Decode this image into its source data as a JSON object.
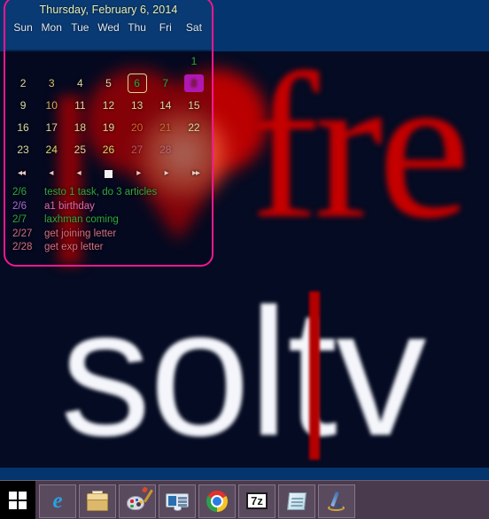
{
  "desktop": {
    "wallpaper": {
      "word_free": "fre",
      "word_soft": "soltv",
      "background_color": "#050b22",
      "band_color": "#05356e",
      "accent_red": "#c40000"
    }
  },
  "calendar_widget": {
    "title": "Thursday, February 6, 2014",
    "border_color": "#f2178f",
    "header_color": "#0a3a73",
    "day_headers": [
      "Sun",
      "Mon",
      "Tue",
      "Wed",
      "Thu",
      "Fri",
      "Sat"
    ],
    "weeks": [
      [
        {
          "label": "",
          "state": "empty",
          "color": ""
        },
        {
          "label": "",
          "state": "empty",
          "color": ""
        },
        {
          "label": "",
          "state": "empty",
          "color": ""
        },
        {
          "label": "",
          "state": "empty",
          "color": ""
        },
        {
          "label": "",
          "state": "empty",
          "color": ""
        },
        {
          "label": "",
          "state": "empty",
          "color": ""
        },
        {
          "label": "1",
          "state": "normal",
          "color": "#2fa83a"
        }
      ],
      [
        {
          "label": "2",
          "state": "normal",
          "color": "#d9d9a0"
        },
        {
          "label": "3",
          "state": "normal",
          "color": "#d9c46a"
        },
        {
          "label": "4",
          "state": "normal",
          "color": "#d9d9a0"
        },
        {
          "label": "5",
          "state": "normal",
          "color": "#d9d9a0"
        },
        {
          "label": "6",
          "state": "today",
          "color": "#2fa83a"
        },
        {
          "label": "7",
          "state": "normal",
          "color": "#2fa83a"
        },
        {
          "label": "8",
          "state": "selected",
          "color": "#8a1f1f"
        }
      ],
      [
        {
          "label": "9",
          "state": "normal",
          "color": "#d9d9a0"
        },
        {
          "label": "10",
          "state": "normal",
          "color": "#d9a860"
        },
        {
          "label": "11",
          "state": "normal",
          "color": "#d9d9a0"
        },
        {
          "label": "12",
          "state": "normal",
          "color": "#d9d9a0"
        },
        {
          "label": "13",
          "state": "normal",
          "color": "#d9d9a0"
        },
        {
          "label": "14",
          "state": "normal",
          "color": "#d9d9a0"
        },
        {
          "label": "15",
          "state": "normal",
          "color": "#d9d9a0"
        }
      ],
      [
        {
          "label": "16",
          "state": "normal",
          "color": "#d9d9a0"
        },
        {
          "label": "17",
          "state": "normal",
          "color": "#d9d9a0"
        },
        {
          "label": "18",
          "state": "normal",
          "color": "#d9d9a0"
        },
        {
          "label": "19",
          "state": "normal",
          "color": "#d9d9a0"
        },
        {
          "label": "20",
          "state": "normal",
          "color": "#e0622a"
        },
        {
          "label": "21",
          "state": "normal",
          "color": "#e0622a"
        },
        {
          "label": "22",
          "state": "normal",
          "color": "#d9d9a0"
        }
      ],
      [
        {
          "label": "23",
          "state": "normal",
          "color": "#d9d9a0"
        },
        {
          "label": "24",
          "state": "normal",
          "color": "#d9d96a"
        },
        {
          "label": "25",
          "state": "normal",
          "color": "#d9d9a0"
        },
        {
          "label": "26",
          "state": "normal",
          "color": "#d9d96a"
        },
        {
          "label": "27",
          "state": "dim",
          "color": "#d46a80"
        },
        {
          "label": "28",
          "state": "dim",
          "color": "#d46a80"
        },
        {
          "label": "",
          "state": "empty",
          "color": ""
        }
      ]
    ],
    "nav": {
      "prev_year": "◂◂",
      "prev_month": "◂",
      "prev_week": "◂",
      "stop": "■",
      "next_week": "▸",
      "next_month": "▸",
      "next_year": "▸▸"
    },
    "tasks": [
      {
        "date": "2/6",
        "text": "testo 1 task, do 3 articles",
        "date_color": "#2fa83a",
        "text_color": "#2fa83a"
      },
      {
        "date": "2/6",
        "text": "a1 birthday",
        "date_color": "#a86bd8",
        "text_color": "#e06ab0"
      },
      {
        "date": "2/7",
        "text": "laxhman coming",
        "date_color": "#2fa83a",
        "text_color": "#2fa83a"
      },
      {
        "date": "2/27",
        "text": "get joining letter",
        "date_color": "#d4707e",
        "text_color": "#d4707e"
      },
      {
        "date": "2/28",
        "text": "get exp letter",
        "date_color": "#d4707e",
        "text_color": "#d4707e"
      }
    ]
  },
  "taskbar": {
    "start_label": "Start",
    "items": [
      {
        "name": "internet-explorer",
        "label": "Internet Explorer"
      },
      {
        "name": "file-explorer",
        "label": "File Explorer"
      },
      {
        "name": "paint",
        "label": "Paint"
      },
      {
        "name": "control-panel",
        "label": "Control Panel"
      },
      {
        "name": "google-chrome",
        "label": "Google Chrome"
      },
      {
        "name": "seven-zip",
        "label": "7-Zip"
      },
      {
        "name": "notepad",
        "label": "Notepad"
      },
      {
        "name": "pen-tool",
        "label": "Pen Tool"
      }
    ],
    "seven_zip_text": "7z"
  }
}
